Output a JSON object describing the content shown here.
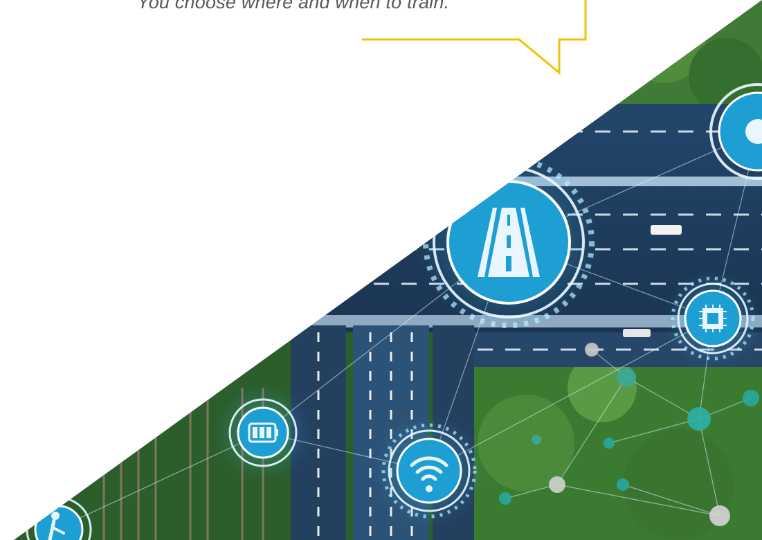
{
  "quote": {
    "text": "You choose where and when to train."
  },
  "colors": {
    "callout_border": "#f2c200",
    "quote_text": "#555a60",
    "road_dark": "#1f3550",
    "overlay_blue": "#1aa6dc",
    "foliage": "#2f6b2a"
  },
  "icons": [
    "road-icon",
    "battery-icon",
    "wifi-icon",
    "chip-icon",
    "pedestrian-icon",
    "node-icon"
  ]
}
